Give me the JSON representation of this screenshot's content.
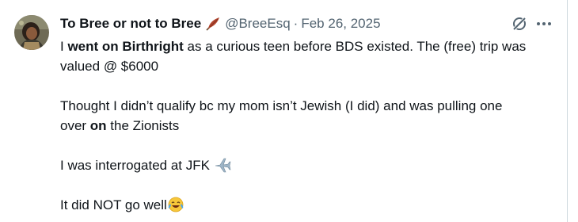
{
  "author": {
    "display_name": "To Bree or not to Bree",
    "name_emoji": "feather-icon",
    "handle": "@BreeEsq",
    "separator": "·",
    "date": "Feb 26, 2025"
  },
  "actions": {
    "grok_icon": "grok-icon",
    "more_icon": "more-icon"
  },
  "tweet": {
    "l1_a": "I ",
    "l1_b": "went on Birthright",
    "l1_c": " as a curious teen before BDS existed. The (free) trip was",
    "l2": "valued @ $6000",
    "l3": "Thought I didn’t qualify bc my mom isn’t Jewish (I did) and was pulling one",
    "l4_a": "over ",
    "l4_b": "on",
    "l4_c": " the Zionists",
    "l5": "I was interrogated at JFK",
    "l5_emoji": "airplane-icon",
    "l6": "It did NOT go well",
    "l6_emoji": "laughing-tears-icon"
  },
  "colors": {
    "text": "#0f1419",
    "secondary": "#536471",
    "border": "#cfd9de"
  }
}
